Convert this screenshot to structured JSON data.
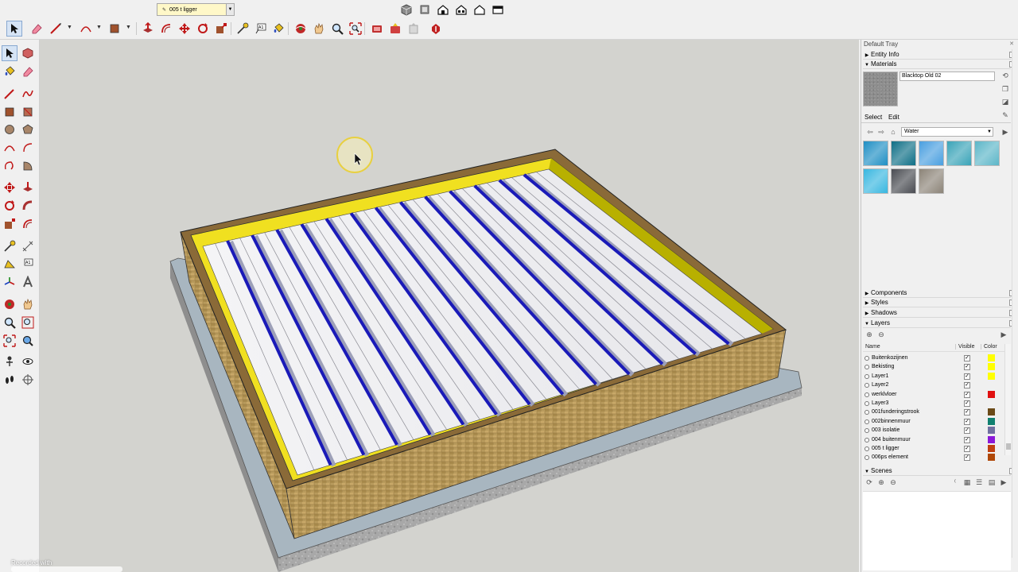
{
  "toolbar": {
    "active_layer": "005 t ligger"
  },
  "tray": {
    "title": "Default Tray",
    "sections": {
      "entity_info": "Entity Info",
      "materials": "Materials",
      "components": "Components",
      "styles": "Styles",
      "shadows": "Shadows",
      "layers": "Layers",
      "scenes": "Scenes"
    },
    "materials": {
      "current_name": "Blacktop Old 02",
      "tab_select": "Select",
      "tab_edit": "Edit",
      "library": "Water",
      "swatches": [
        "#1f8fc4",
        "#0e6f86",
        "#4a9fe0",
        "#3aa4b8",
        "#5cb6c8",
        "#39b7e0",
        "#4a4c52",
        "#8c8478"
      ]
    },
    "layers": {
      "col_name": "Name",
      "col_visible": "Visible",
      "col_color": "Color",
      "items": [
        {
          "name": "Buitenkozijnen",
          "visible": true,
          "color": "#ffff00"
        },
        {
          "name": "Bekisting",
          "visible": true,
          "color": "#ffff00"
        },
        {
          "name": "Layer1",
          "visible": true,
          "color": "#ffff00"
        },
        {
          "name": "Layer2",
          "visible": true,
          "color": ""
        },
        {
          "name": "werklvloer",
          "visible": true,
          "color": "#e01010"
        },
        {
          "name": "Layer3",
          "visible": true,
          "color": ""
        },
        {
          "name": "001funderingstrook",
          "visible": true,
          "color": "#6b4a18"
        },
        {
          "name": "002binnenmuur",
          "visible": true,
          "color": "#108070"
        },
        {
          "name": "003 isolatie",
          "visible": true,
          "color": "#7070a0"
        },
        {
          "name": "004 buitenmuur",
          "visible": true,
          "color": "#8a18d8"
        },
        {
          "name": "005 t ligger",
          "visible": true,
          "color": "#c04010"
        },
        {
          "name": "006ps element",
          "visible": true,
          "color": "#b04808"
        }
      ]
    }
  },
  "watermark": "Recorded with"
}
